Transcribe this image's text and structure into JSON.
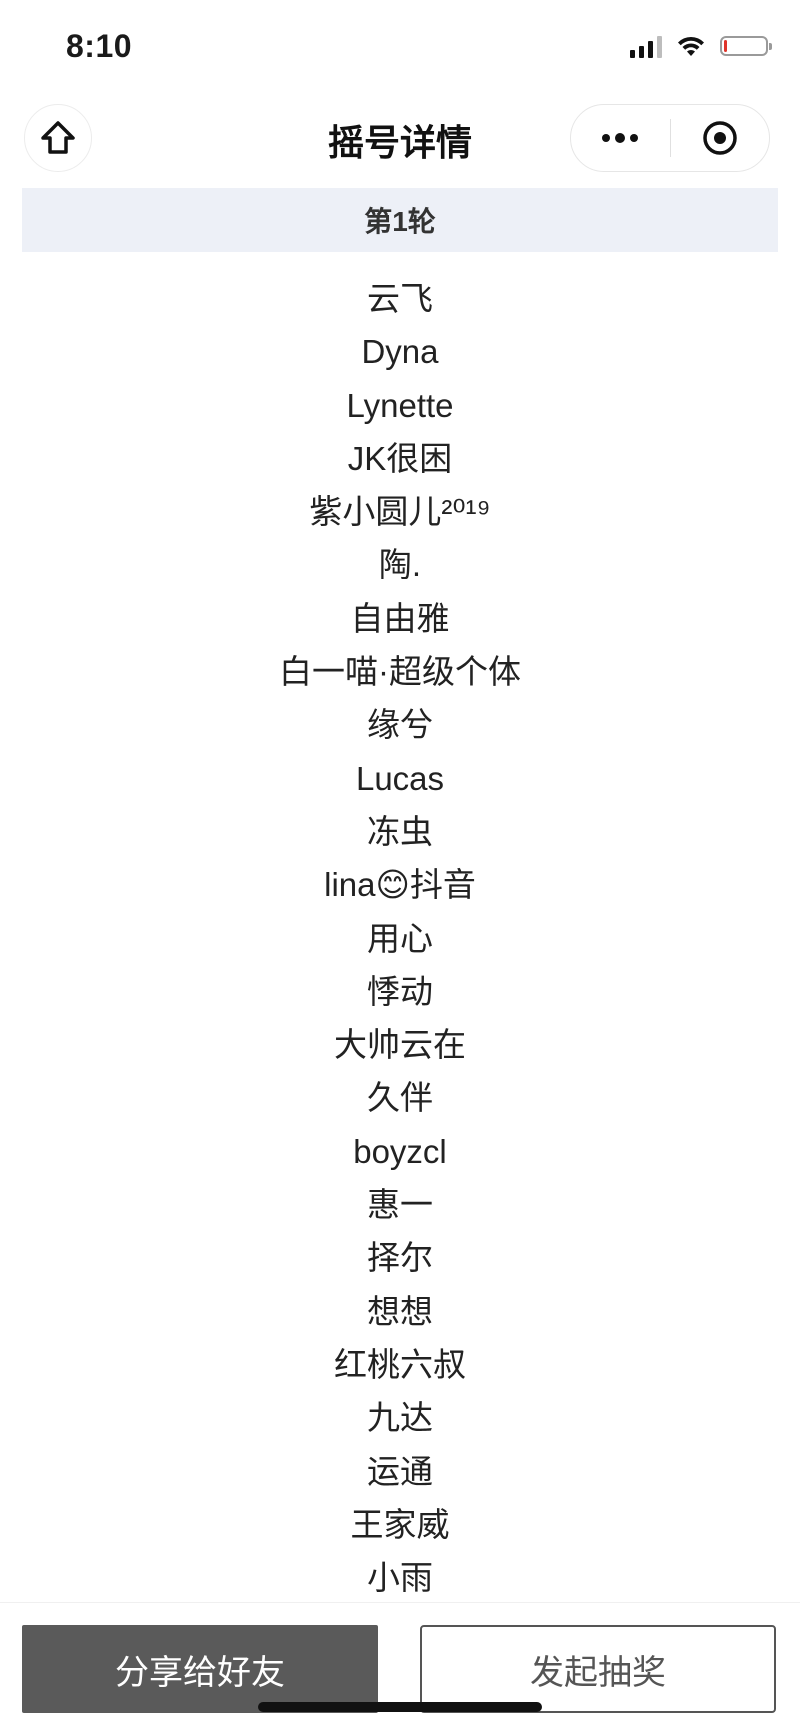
{
  "status_bar": {
    "time": "8:10",
    "battery_level": 0.08,
    "battery_color": "#e0342b"
  },
  "nav": {
    "title": "摇号详情",
    "home_icon": "home-icon",
    "more_icon": "more-dots-icon",
    "close_icon": "target-close-icon"
  },
  "round": {
    "label": "第1轮"
  },
  "names": [
    "云飞",
    "Dyna",
    "Lynette",
    "JK很困",
    "紫小圆儿²⁰¹⁹",
    "陶.",
    "自由雅",
    "白一喵·超级个体",
    "缘兮",
    "Lucas",
    "冻虫",
    "lina😊抖音",
    "用心",
    "悸动",
    "大帅云在",
    "久伴",
    "boyzcl",
    "惠一",
    "择尔",
    "想想",
    "红桃六叔",
    "九达",
    "运通",
    "王家威",
    "小雨"
  ],
  "actions": {
    "share_label": "分享给好友",
    "start_label": "发起抽奖",
    "share_bg": "#5a5a5a"
  }
}
